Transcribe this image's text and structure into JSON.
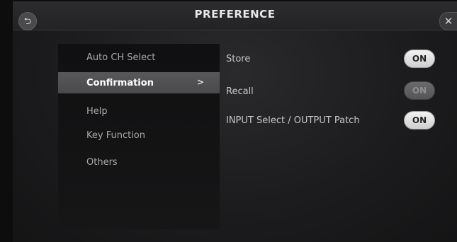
{
  "header": {
    "title": "PREFERENCE",
    "back_icon": "back-arrow-icon",
    "back_glyph": "⮌",
    "close_icon": "close-icon",
    "close_glyph": "✕"
  },
  "sidebar": {
    "items": [
      {
        "label": "Auto CH Select",
        "active": false
      },
      {
        "label": "Confirmation",
        "active": true,
        "chevron": ">"
      },
      {
        "label": "Help",
        "active": false
      },
      {
        "label": "Key Function",
        "active": false
      },
      {
        "label": "Others",
        "active": false
      }
    ]
  },
  "settings": {
    "rows": [
      {
        "label": "Store",
        "toggle": "ON",
        "enabled": true
      },
      {
        "label": "Recall",
        "toggle": "ON",
        "enabled": false
      },
      {
        "label": "INPUT Select / OUTPUT Patch",
        "toggle": "ON",
        "enabled": true
      }
    ]
  },
  "colors": {
    "toggle_on": "#e6e6e6",
    "toggle_off": "#5f5f62",
    "active_item": "#505053"
  }
}
